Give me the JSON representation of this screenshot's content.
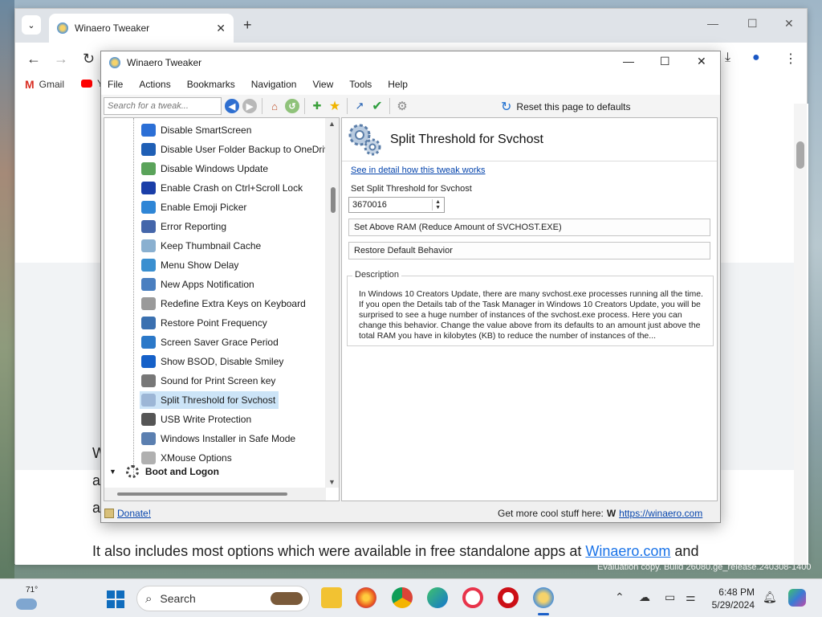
{
  "browser": {
    "tab_title": "Winaero Tweaker",
    "bookmarks": [
      {
        "label": "Gmail"
      },
      {
        "label": "Y"
      }
    ],
    "page_text_line": "It also includes most options which were available in free standalone apps at",
    "page_link": "Winaero.com",
    "page_text_end": "and",
    "page_fragments": [
      "W",
      "a",
      "a"
    ]
  },
  "app": {
    "title": "Winaero Tweaker",
    "menu": [
      "File",
      "Actions",
      "Bookmarks",
      "Navigation",
      "View",
      "Tools",
      "Help"
    ],
    "search_placeholder": "Search for a tweak...",
    "reset_label": "Reset this page to defaults",
    "tree_items": [
      {
        "label": "Disable SmartScreen",
        "icon": "shield-icon",
        "color": "#2b6fd6"
      },
      {
        "label": "Disable User Folder Backup to OneDrive",
        "icon": "cloud-icon",
        "color": "#1f5fb5"
      },
      {
        "label": "Disable Windows Update",
        "icon": "update-icon",
        "color": "#5aa35a"
      },
      {
        "label": "Enable Crash on Ctrl+Scroll Lock",
        "icon": "crash-icon",
        "color": "#1a3ea8"
      },
      {
        "label": "Enable Emoji Picker",
        "icon": "emoji-icon",
        "color": "#2f86d6"
      },
      {
        "label": "Error Reporting",
        "icon": "flag-icon",
        "color": "#4466aa"
      },
      {
        "label": "Keep Thumbnail Cache",
        "icon": "magnifier-icon",
        "color": "#8ab0d0"
      },
      {
        "label": "Menu Show Delay",
        "icon": "cursor-icon",
        "color": "#3a8fd0"
      },
      {
        "label": "New Apps Notification",
        "icon": "notification-icon",
        "color": "#4a7fc0"
      },
      {
        "label": "Redefine Extra Keys on Keyboard",
        "icon": "keyboard-icon",
        "color": "#9a9a9a"
      },
      {
        "label": "Restore Point Frequency",
        "icon": "restore-icon",
        "color": "#3a70b0"
      },
      {
        "label": "Screen Saver Grace Period",
        "icon": "monitor-icon",
        "color": "#2b78c8"
      },
      {
        "label": "Show BSOD, Disable Smiley",
        "icon": "bsod-icon",
        "color": "#1560c8"
      },
      {
        "label": "Sound for Print Screen key",
        "icon": "speaker-icon",
        "color": "#777777"
      },
      {
        "label": "Split Threshold for Svchost",
        "icon": "gears-icon",
        "color": "#9cb6d6",
        "selected": true
      },
      {
        "label": "USB Write Protection",
        "icon": "usb-icon",
        "color": "#555555"
      },
      {
        "label": "Windows Installer in Safe Mode",
        "icon": "installer-icon",
        "color": "#5b7fb0"
      },
      {
        "label": "XMouse Options",
        "icon": "mouse-icon",
        "color": "#b0b0b0"
      }
    ],
    "tree_group": "Boot and Logon",
    "panel": {
      "title": "Split Threshold for Svchost",
      "detail_link": "See in detail how this tweak works",
      "field_label": "Set Split Threshold for Svchost",
      "field_value": "3670016",
      "btn_above_ram": "Set Above RAM (Reduce Amount of SVCHOST.EXE)",
      "btn_restore": "Restore Default Behavior",
      "desc_legend": "Description",
      "desc_text": "In Windows 10 Creators Update, there are many svchost.exe processes running all the time. If you open the Details tab of the Task Manager in Windows 10 Creators Update, you will be surprised to see a huge number of instances of the svchost.exe process. Here you can change this behavior. Change the value above from its defaults to an amount just above the total RAM you have in kilobytes (KB) to reduce the number of instances of the..."
    },
    "status": {
      "donate": "Donate!",
      "more_text": "Get more cool stuff here:",
      "more_link": "https://winaero.com"
    }
  },
  "desktop": {
    "eval_text": "Evaluation copy. Build 26080.ge_release.240308-1400"
  },
  "taskbar": {
    "temperature": "71°",
    "search_label": "Search",
    "time": "6:48 PM",
    "date": "5/29/2024"
  }
}
